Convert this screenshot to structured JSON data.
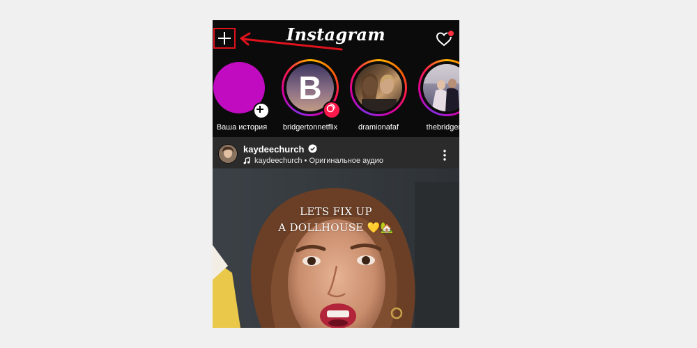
{
  "header": {
    "logo": "Instagram",
    "add_icon": "plus-icon",
    "activity_icon": "heart-icon"
  },
  "stories": [
    {
      "label": "Ваша история",
      "type": "own",
      "color": "#c00bc0"
    },
    {
      "label": "bridgertonnetflix",
      "type": "letter",
      "letter": "B"
    },
    {
      "label": "dramionafaf",
      "type": "photo"
    },
    {
      "label": "thebridgerto",
      "type": "photo"
    }
  ],
  "post": {
    "username": "kaydeechurch",
    "audio": "kaydeechurch • Оригинальное аудио",
    "caption_line1": "LETS FIX UP",
    "caption_line2": "A DOLLHOUSE 💛🏡"
  },
  "colors": {
    "highlight_red": "#e0121c",
    "story_gradient": [
      "#ffb400",
      "#ff1a4b",
      "#d100a6"
    ],
    "notification_dot": "#ff3040"
  }
}
